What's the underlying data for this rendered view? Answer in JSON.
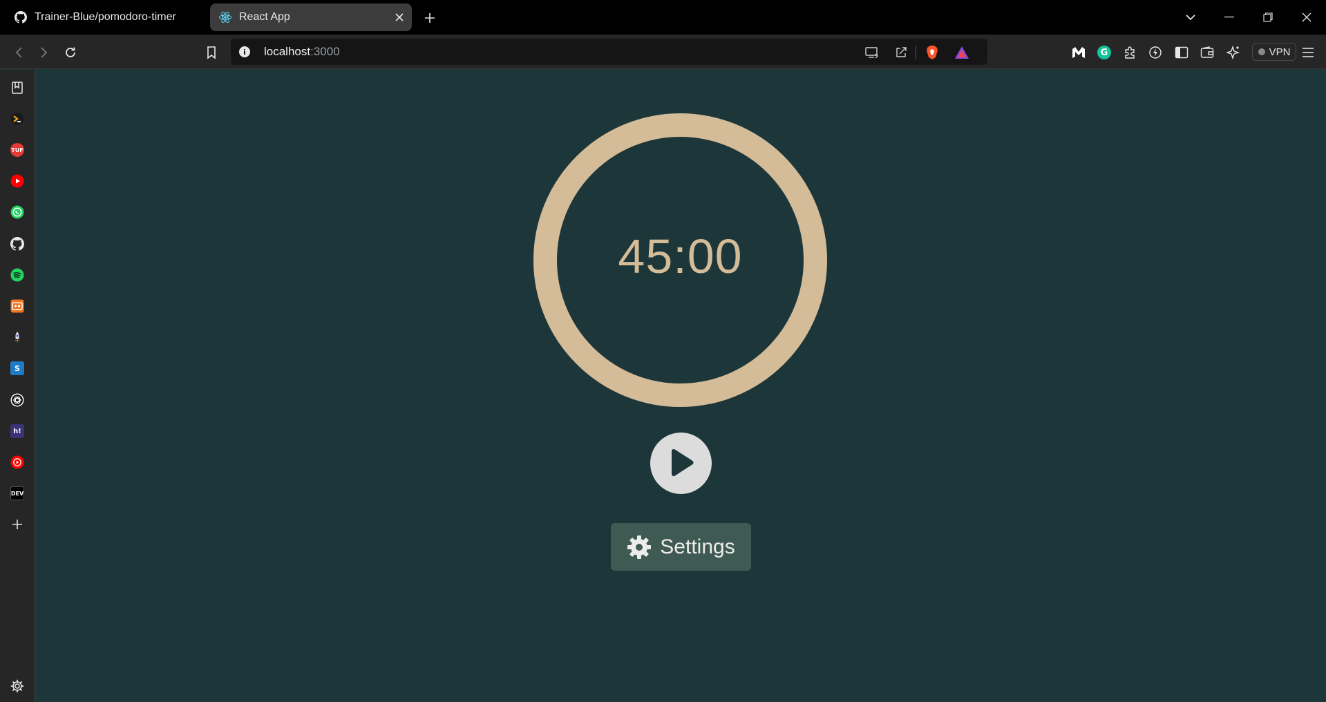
{
  "tabs": [
    {
      "title": "Trainer-Blue/pomodoro-timer",
      "icon": "github-icon",
      "active": false
    },
    {
      "title": "React App",
      "icon": "react-icon",
      "active": true
    }
  ],
  "toolbar": {
    "url_host": "localhost",
    "url_port": ":3000",
    "vpn_label": "VPN"
  },
  "sidebar": {
    "items": [
      "reading-list-icon",
      "prompt-icon",
      "tuf-icon",
      "youtube-icon",
      "whatsapp-icon",
      "github-icon",
      "spotify-icon",
      "crunchyroll-icon",
      "rocket-icon",
      "scribd-icon",
      "chatgpt-icon",
      "hashnode-icon",
      "youtube-music-icon",
      "dev-icon",
      "add-icon"
    ],
    "labels": {
      "tuf": "TUF",
      "scribd": "S",
      "hashnode": "h!",
      "dev": "DEV"
    }
  },
  "timer": {
    "display": "45:00"
  },
  "settings": {
    "label": "Settings"
  },
  "colors": {
    "background": "#1d3639",
    "ring": "#d4bc98",
    "play_button": "#dcdcdc",
    "settings_button": "#3e5a52"
  }
}
